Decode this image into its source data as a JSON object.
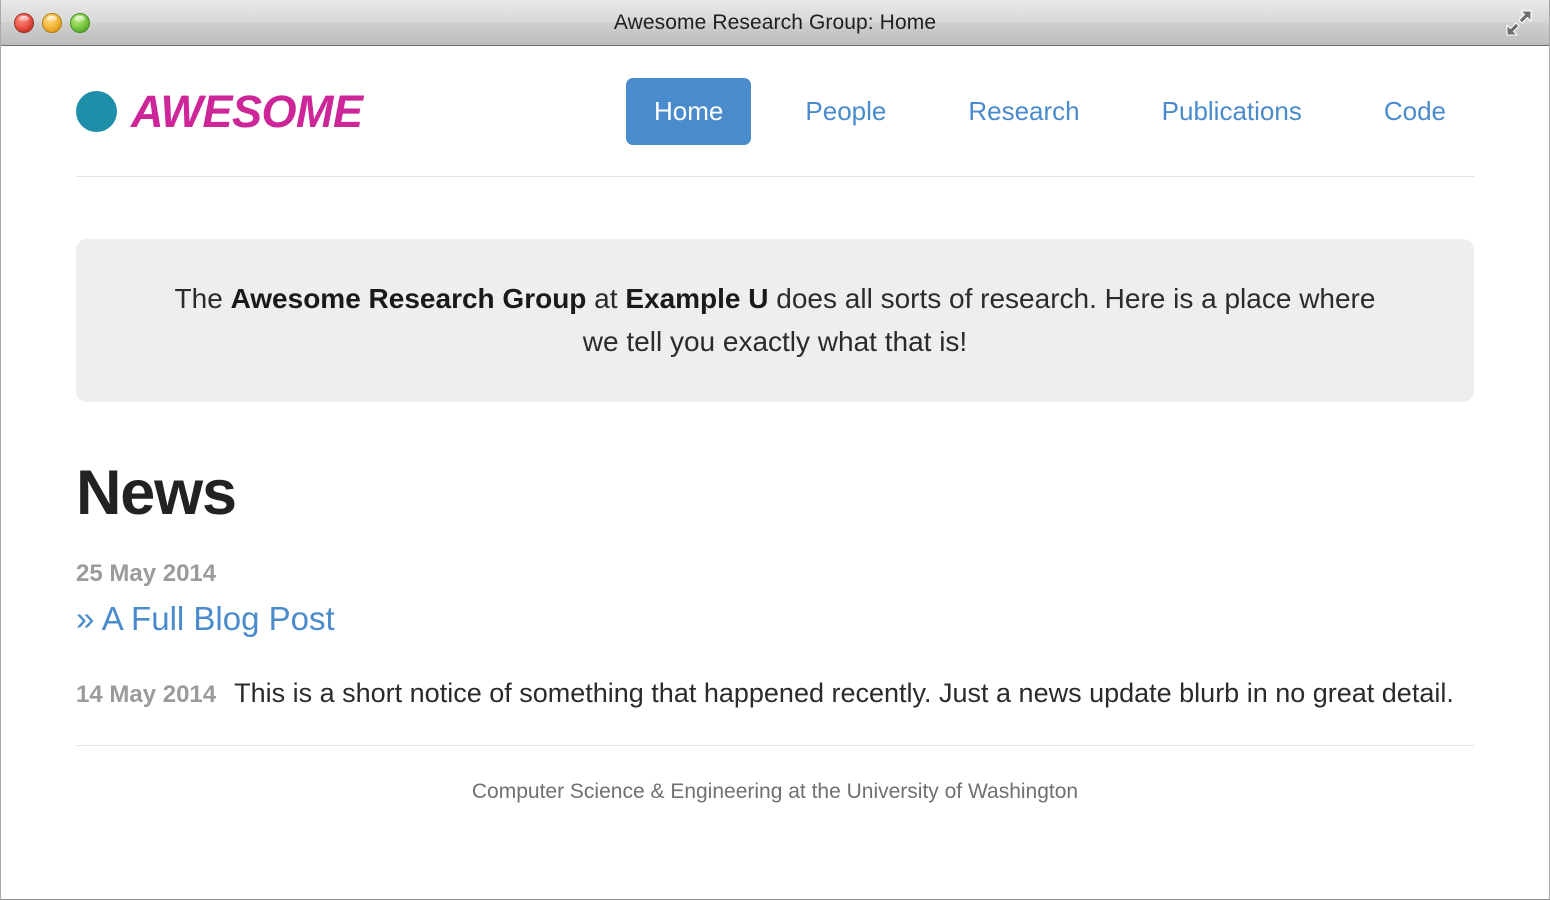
{
  "window": {
    "title": "Awesome Research Group: Home",
    "controls": {
      "close_label": "Close",
      "minimize_label": "Minimize",
      "zoom_label": "Zoom",
      "fullscreen_label": "Enter Full Screen"
    },
    "colors": {
      "close": "#ee5f52",
      "minimize": "#f6bd44",
      "zoom": "#86d04c",
      "titlebar": "#d8d8d8"
    }
  },
  "brand": {
    "name": "AWESOME",
    "dot_color": "#1e8fa8",
    "name_color": "#cc2699"
  },
  "nav": {
    "accent_color": "#4a8bcb",
    "items": [
      {
        "label": "Home",
        "active": true
      },
      {
        "label": "People",
        "active": false
      },
      {
        "label": "Research",
        "active": false
      },
      {
        "label": "Publications",
        "active": false
      },
      {
        "label": "Code",
        "active": false
      }
    ]
  },
  "jumbotron": {
    "background_color": "#eeeeee",
    "text_before": "The ",
    "bold_1": "Awesome Research Group",
    "text_middle": " at ",
    "bold_2": "Example U",
    "text_after": " does all sorts of research. Here is a place where we tell you exactly what that is!"
  },
  "news": {
    "heading": "News",
    "entries": [
      {
        "date": "25 May 2014",
        "link_text": "» A Full Blog Post",
        "body": ""
      },
      {
        "date": "14 May 2014",
        "link_text": "",
        "body": "This is a short notice of something that happened recently. Just a news update blurb in no great detail."
      }
    ]
  },
  "footer": {
    "text": "Computer Science & Engineering at the University of Washington"
  }
}
